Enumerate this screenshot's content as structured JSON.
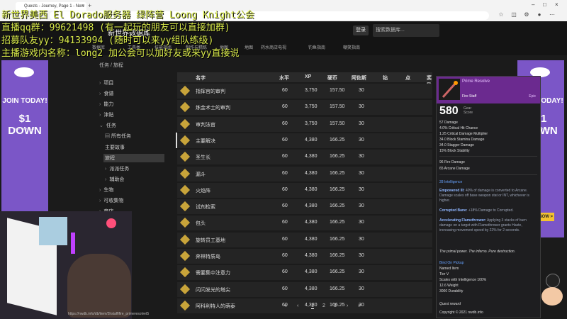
{
  "browser": {
    "tab_title": "Quests - Journey, Page 1 - New",
    "status_url": "https://nwdb.info/db/item/2hstaffifire_primeresolvet5"
  },
  "overlay": {
    "line1": "新世界美西 El Dorado服务器 绿阵营 Loong Knight公会",
    "line2": "直播qq群：99621498 (有一起玩的朋友可以直接加群)",
    "line3": "招募队友yy：94133994 (随时可以来yy组队练级)",
    "line4": "主播游戏内名称：long2 加公会可以加好友或来yy直接说"
  },
  "header": {
    "logo": "新世界数据库",
    "login_label": "登录",
    "search_placeholder": "搜索数据库..."
  },
  "nav": [
    "数据库",
    "工具类",
    "技能指南",
    "制作与精炼",
    "地图",
    "地图",
    "药水商店电视",
    "钓鱼指南",
    "嘲笑指南"
  ],
  "ads": {
    "join": "JOIN TODAY!",
    "price": "$1 DOWN",
    "sub": "AND THEN JUST",
    "button": "BUY NOW >"
  },
  "breadcrumb": "任务 / 旅程",
  "sidebar": [
    {
      "label": "项目",
      "chev": "›"
    },
    {
      "label": "食谱",
      "chev": "›"
    },
    {
      "label": "能力",
      "chev": "›"
    },
    {
      "label": "津贴",
      "chev": "›"
    },
    {
      "label": "任务",
      "chev": "⌄"
    },
    {
      "label": "所有任务",
      "chev": ""
    },
    {
      "label": "主要故事",
      "chev": ""
    },
    {
      "label": "旅程",
      "chev": ""
    },
    {
      "label": "派派任务",
      "chev": "›"
    },
    {
      "label": "辅助会",
      "chev": "›"
    },
    {
      "label": "生物",
      "chev": "›"
    },
    {
      "label": "可收集物",
      "chev": "›"
    },
    {
      "label": "商店",
      "chev": "›"
    }
  ],
  "table": {
    "headers": [
      "名字",
      "水平",
      "XP",
      "硬币",
      "阿佐斯",
      "钻",
      "点",
      "奖励"
    ],
    "rows": [
      {
        "name": "指挥官的审判",
        "level": "60",
        "xp": "3,750",
        "coin": "157.50",
        "azoth": "30"
      },
      {
        "name": "炼金术士的审判",
        "level": "60",
        "xp": "3,750",
        "coin": "157.50",
        "azoth": "30"
      },
      {
        "name": "审判法官",
        "level": "60",
        "xp": "3,750",
        "coin": "157.50",
        "azoth": "30"
      },
      {
        "name": "主要解决",
        "level": "60",
        "xp": "4,380",
        "coin": "166.25",
        "azoth": "30"
      },
      {
        "name": "圣生长",
        "level": "60",
        "xp": "4,380",
        "coin": "166.25",
        "azoth": "30"
      },
      {
        "name": "漏斗",
        "level": "60",
        "xp": "4,380",
        "coin": "166.25",
        "azoth": "30"
      },
      {
        "name": "火焰阵",
        "level": "60",
        "xp": "4,380",
        "coin": "166.25",
        "azoth": "30"
      },
      {
        "name": "试剂检索",
        "level": "60",
        "xp": "4,380",
        "coin": "166.25",
        "azoth": "30"
      },
      {
        "name": "包头",
        "level": "60",
        "xp": "4,380",
        "coin": "166.25",
        "azoth": "30"
      },
      {
        "name": "旋转员工基地",
        "level": "60",
        "xp": "4,380",
        "coin": "166.25",
        "azoth": "30"
      },
      {
        "name": "奔林特质岛",
        "level": "60",
        "xp": "4,380",
        "coin": "166.25",
        "azoth": "30"
      },
      {
        "name": "需要集中注意力",
        "level": "60",
        "xp": "4,380",
        "coin": "166.25",
        "azoth": "30"
      },
      {
        "name": "闪闪发光的塔尖",
        "level": "60",
        "xp": "4,380",
        "coin": "166.25",
        "azoth": "30"
      },
      {
        "name": "阿科利特人的萌泰",
        "level": "60",
        "xp": "4,380",
        "coin": "166.25",
        "azoth": "30"
      }
    ]
  },
  "pager": {
    "first": "«",
    "prev": "‹",
    "p1": "1",
    "p2": "2",
    "p3": "3",
    "next": "›",
    "last": "»"
  },
  "card": {
    "title": "Prime Resolve",
    "type": "Fire Staff",
    "rarity": "Epic",
    "gear_score": "580",
    "gear_label1": "Gear",
    "gear_label2": "Score",
    "stats": [
      "57 Damage",
      "4.0% Critical Hit Chance",
      "1.25 Critical Damage Multiplier",
      "34.0 Block Stamina Damage",
      "34.0 Stagger Damage",
      "15% Block Stability"
    ],
    "dmg1": "96 Fire Damage",
    "dmg2": "65 Arcane Damage",
    "attr": "28 Intelligence",
    "perk1_title": "Empowered III:",
    "perk1_desc": "40% of damage is converted to Arcane. Damage scales off base weapon stat or INT, whichever is higher.",
    "perk2_title": "Corrupted Bane:",
    "perk2_desc": "+18% Damage to Corrupted.",
    "perk3_title": "Accelerating Flamethrower:",
    "perk3_desc": "Applying 3 stacks of burn damage on a target with Flamethrower grants Haste, increasing movement speed by 22% for 2 seconds.",
    "flavor": "The primal power. The inferno. Pure destruction.",
    "bind": "Bind On Pickup",
    "named": "Named Item",
    "tier": "Tier V",
    "scales": "Scales with Intelligence 100%",
    "weight": "12.6 Weight",
    "durability": "3000 Durability",
    "reward": "Quest reward",
    "copyright": "Copyright © 2021 nwdb.info"
  }
}
